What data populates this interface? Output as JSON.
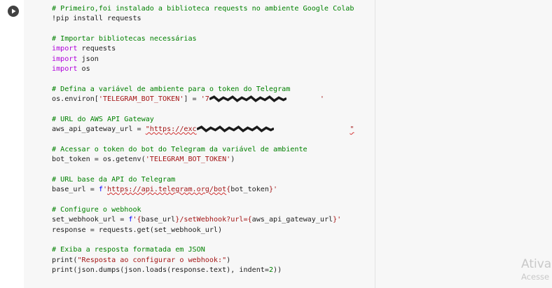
{
  "cell": {
    "run_icon": "play-icon",
    "lines": [
      {
        "parts": [
          {
            "t": "c",
            "v": "# Primeiro,foi instalado a biblioteca requests no ambiente Google Colab"
          }
        ]
      },
      {
        "parts": [
          {
            "t": "n",
            "v": "!pip install requests"
          }
        ]
      },
      {
        "parts": []
      },
      {
        "parts": [
          {
            "t": "c",
            "v": "# Importar bibliotecas necessárias"
          }
        ]
      },
      {
        "parts": [
          {
            "t": "k",
            "v": "import"
          },
          {
            "t": "n",
            "v": " requests"
          }
        ]
      },
      {
        "parts": [
          {
            "t": "k",
            "v": "import"
          },
          {
            "t": "n",
            "v": " json"
          }
        ]
      },
      {
        "parts": [
          {
            "t": "k",
            "v": "import"
          },
          {
            "t": "n",
            "v": " os"
          }
        ]
      },
      {
        "parts": []
      },
      {
        "parts": [
          {
            "t": "c",
            "v": "# Defina a variável de ambiente para o token do Telegram"
          }
        ]
      },
      {
        "parts": [
          {
            "t": "n",
            "v": "os.environ["
          },
          {
            "t": "s",
            "v": "'TELEGRAM_BOT_TOKEN'"
          },
          {
            "t": "n",
            "v": "] = "
          },
          {
            "t": "s",
            "v": "'7"
          },
          {
            "t": "r",
            "v": "                          "
          },
          {
            "t": "s",
            "v": "'"
          }
        ]
      },
      {
        "parts": []
      },
      {
        "parts": [
          {
            "t": "c",
            "v": "# URL do AWS API Gateway"
          }
        ]
      },
      {
        "parts": [
          {
            "t": "n",
            "v": "aws_api_gateway_url = "
          },
          {
            "t": "sq",
            "v": "\"https://exc"
          },
          {
            "t": "r",
            "v": "                                    "
          },
          {
            "t": "sq",
            "v": "\""
          }
        ]
      },
      {
        "parts": []
      },
      {
        "parts": [
          {
            "t": "c",
            "v": "# Acessar o token do bot do Telegram da variável de ambiente"
          }
        ]
      },
      {
        "parts": [
          {
            "t": "n",
            "v": "bot_token = os.getenv("
          },
          {
            "t": "s",
            "v": "'TELEGRAM_BOT_TOKEN'"
          },
          {
            "t": "n",
            "v": ")"
          }
        ]
      },
      {
        "parts": []
      },
      {
        "parts": [
          {
            "t": "c",
            "v": "# URL base da API do Telegram"
          }
        ]
      },
      {
        "parts": [
          {
            "t": "n",
            "v": "base_url = "
          },
          {
            "t": "p",
            "v": "f"
          },
          {
            "t": "s",
            "v": "'"
          },
          {
            "t": "sq",
            "v": "https://api.telegram.org/bot"
          },
          {
            "t": "s",
            "v": "{"
          },
          {
            "t": "n",
            "v": "bot_token"
          },
          {
            "t": "s",
            "v": "}'"
          }
        ]
      },
      {
        "parts": []
      },
      {
        "parts": [
          {
            "t": "c",
            "v": "# Configure o webhook"
          }
        ]
      },
      {
        "parts": [
          {
            "t": "n",
            "v": "set_webhook_url = "
          },
          {
            "t": "p",
            "v": "f"
          },
          {
            "t": "s",
            "v": "'{"
          },
          {
            "t": "n",
            "v": "base_url"
          },
          {
            "t": "s",
            "v": "}/setWebhook?url={"
          },
          {
            "t": "n",
            "v": "aws_api_gateway_url"
          },
          {
            "t": "s",
            "v": "}'"
          }
        ]
      },
      {
        "parts": [
          {
            "t": "n",
            "v": "response = requests.get(set_webhook_url)"
          }
        ]
      },
      {
        "parts": []
      },
      {
        "parts": [
          {
            "t": "c",
            "v": "# Exiba a resposta formatada em JSON"
          }
        ]
      },
      {
        "parts": [
          {
            "t": "n",
            "v": "print("
          },
          {
            "t": "s",
            "v": "\"Resposta ao configurar o webhook:\""
          },
          {
            "t": "n",
            "v": ")"
          }
        ]
      },
      {
        "parts": [
          {
            "t": "n",
            "v": "print(json.dumps(json.loads(response.text), indent="
          },
          {
            "t": "g",
            "v": "2"
          },
          {
            "t": "n",
            "v": "))"
          }
        ]
      }
    ]
  },
  "watermark": {
    "line1": "Ativar o Windows",
    "line2": "Acesse Configurações para ativar o Windows."
  },
  "colors": {
    "comment": "#008000",
    "keyword": "#af00db",
    "string": "#a31515",
    "prefix": "#0000ff",
    "squiggle": "#d32f2f"
  }
}
